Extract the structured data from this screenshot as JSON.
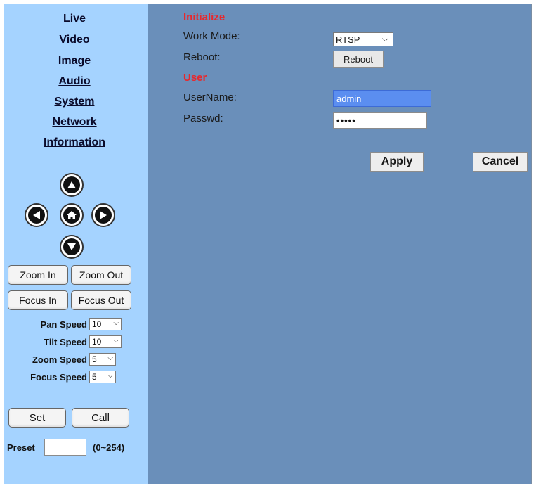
{
  "sidebar": {
    "nav": [
      "Live",
      "Video",
      "Image",
      "Audio",
      "System",
      "Network",
      "Information"
    ],
    "ptz": {
      "up_icon": "arrow-up-icon",
      "left_icon": "arrow-left-icon",
      "home_icon": "home-icon",
      "right_icon": "arrow-right-icon",
      "down_icon": "arrow-down-icon"
    },
    "buttons": {
      "zoom_in": "Zoom In",
      "zoom_out": "Zoom Out",
      "focus_in": "Focus In",
      "focus_out": "Focus Out"
    },
    "speeds": [
      {
        "label": "Pan Speed",
        "value": "10"
      },
      {
        "label": "Tilt Speed",
        "value": "10"
      },
      {
        "label": "Zoom Speed",
        "value": "5"
      },
      {
        "label": "Focus Speed",
        "value": "5"
      }
    ],
    "set_label": "Set",
    "call_label": "Call",
    "preset_label": "Preset",
    "preset_value": "",
    "preset_range": "(0~254)"
  },
  "main": {
    "initialize_title": "Initialize",
    "work_mode_label": "Work Mode:",
    "work_mode_value": "RTSP",
    "reboot_label": "Reboot:",
    "reboot_button": "Reboot",
    "user_title": "User",
    "username_label": "UserName:",
    "username_value": "admin",
    "passwd_label": "Passwd:",
    "passwd_value": "•••••",
    "apply_button": "Apply",
    "cancel_button": "Cancel"
  },
  "colors": {
    "sidebar_bg": "#a5d3ff",
    "main_bg": "#6a8fba",
    "section_title": "#e8282c",
    "username_bg": "#5b8ef0"
  }
}
